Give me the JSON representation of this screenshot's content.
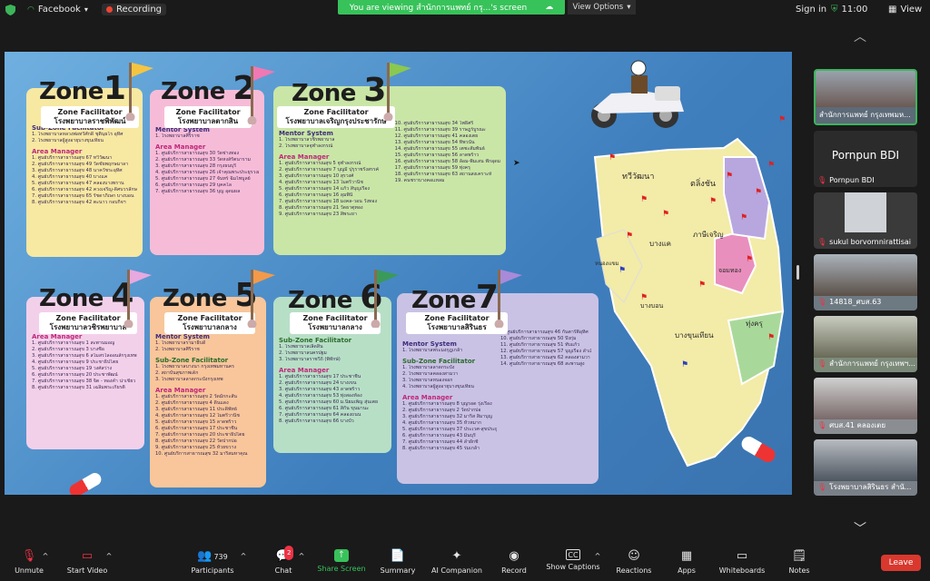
{
  "topbar": {
    "app_label": "Facebook",
    "recording_label": "Recording",
    "share_banner": "You are viewing สำนักการแพทย์ กรุ...'s screen",
    "view_options": "View Options",
    "sign_in": "Sign in",
    "time": "11:00",
    "view_label": "View"
  },
  "slide": {
    "zones": [
      {
        "title": "Zone",
        "num": "1",
        "fac_label": "Zone Facilitator",
        "fac_name": "โรงพยาบาลราชพิพัฒน์",
        "sections": [
          {
            "head": "Sub-Zone Facilitator",
            "lines": [
              "1. โรงพยาบาลหลวงพ่อทวีศักดิ์ ชุตินฺธโร อุทิศ",
              "2. โรงพยาบาลผู้สูงอายุบางขุนเทียน"
            ]
          },
          {
            "head": "Area Manager",
            "lines": [
              "1. ศูนย์บริการสาธารณสุข 67 ทวีวัฒนา",
              "2. ศูนย์บริการสาธารณสุข 49 วัดชัยพฤกษมาลา",
              "3. ศูนย์บริการสาธารณสุข 48 นาควัชระอุทิศ",
              "4. ศูนย์บริการสาธารณสุข 40 บางแค",
              "5. ศูนย์บริการสาธารณสุข 47 คลองบางพราน",
              "6. ศูนย์บริการสาธารณสุข 42 ควงเจริญ-ดิศบวรลักษณ์ ฐานปัญญา",
              "7. ศูนย์บริการสาธารณสุข 65 รัชดาภิเษก บางบอน",
              "8. ศูนย์บริการสาธารณสุข 42 ตะนาว กอบกิจฯ"
            ]
          }
        ]
      },
      {
        "title": "Zone",
        "num": "2",
        "fac_label": "Zone Facilitator",
        "fac_name": "โรงพยาบาลตากสิน",
        "sections": [
          {
            "head": "Mentor System",
            "lines": [
              "1. โรงพยาบาลศิริราช"
            ]
          },
          {
            "head": "Area Manager",
            "lines": [
              "1. ศูนย์บริการสาธารณสุข 30 วัดช่างทอง",
              "2. ศูนย์บริการสาธารณสุข 33 วัดหงส์รัตนาราม",
              "3. ศูนย์บริการสาธารณสุข 28 กรุงธนบุรี",
              "4. ศูนย์บริการสาธารณสุข 26 เจ้าคุณพระประยุรวงศ์",
              "5. ศูนย์บริการสาธารณสุข 27 จันทร์ ฉิมไพบูลย์",
              "6. ศูนย์บริการสาธารณสุข 29 บุคคโล",
              "7. ศูนย์บริการสาธารณสุข 36 บุญ อุดมผล"
            ]
          }
        ]
      },
      {
        "title": "Zone",
        "num": "3",
        "fac_label": "Zone Facilitator",
        "fac_name": "โรงพยาบาลเจริญกรุงประชารักษ์",
        "sections": [
          {
            "head": "Mentor System",
            "lines": [
              "1. โรงพยาบาลวชิรพยาบาล",
              "2. โรงพยาบาลจุฬาลงกรณ์"
            ]
          },
          {
            "head": "Area Manager",
            "lines": [
              "1. ศูนย์บริการสาธารณสุข 5 จุฬาลงกรณ์",
              "2. ศูนย์บริการสาธารณสุข 7 บุญมี ปุรุราชรังสรรค์",
              "3. ศูนย์บริการสาธารณสุข 10 สุรวงศ์",
              "4. ศูนย์บริการสาธารณสุข 13 ไมตรีวานิช",
              "5. ศูนย์บริการสาธารณสุข 14 แก้ว สีบุญเรือง",
              "6. ศูนย์บริการสาธารณสุข 16 ลุมพินี",
              "7. ศูนย์บริการสาธารณสุข 18 มงคล-วอน วังทอง",
              "8. ศูนย์บริการสาธารณสุข 21 วัดธาตุทอง",
              "9. ศูนย์บริการสาธารณสุข 23 สี่พระยา",
              "10. ศูนย์บริการสาธารณสุข 34 โพธิศรี",
              "11. ศูนย์บริการสาธารณสุข 39 ราษฎร์บูรณะ",
              "12. ศูนย์บริการสาธารณสุข 41 คลองเตย",
              "13. ศูนย์บริการสาธารณสุข 54 ทิพวนัน",
              "14. ศูนย์บริการสาธารณสุข 55 เตชะสัมพันธ์",
              "15. ศูนย์บริการสาธารณสุข 56 ลาดพร้าว",
              "16. ศูนย์บริการสาธารณสุข 58 ล้อม-พิมเสน ฟักอุดม",
              "17. ศูนย์บริการสาธารณสุข 59 ทุ่งครุ",
              "18. ศูนย์บริการสาธารณสุข 63 สถานสงเคราะห์",
              "19. คนชราบางคอแหลม"
            ]
          }
        ]
      },
      {
        "title": "Zone",
        "num": "4",
        "fac_label": "Zone Facilitator",
        "fac_name": "โรงพยาบาลวชิรพยาบาล",
        "sections": [
          {
            "head": "Area Manager",
            "lines": [
              "1. ศูนย์บริการสาธารณสุข 1 สะพานมอญ",
              "2. ศูนย์บริการสาธารณสุข 3 บางซื่อ",
              "3. ศูนย์บริการสาธารณสุข 6 สโมสรไลออนส์กรุงเทพ",
              "4. ศูนย์บริการสาธารณสุข 9 ประชาธิปไตย",
              "5. ศูนย์บริการสาธารณสุข 19 วงศ์สว่าง",
              "6. ศูนย์บริการสาธารณสุข 20 ประชาพัฒน์",
              "7. ศูนย์บริการสาธารณสุข 38 จิต - ทองคำ น่าเชี่ยว",
              "8. ศูนย์บริการสาธารณสุข 31 เฉลิมพระเกียรติ"
            ]
          }
        ]
      },
      {
        "title": "Zone",
        "num": "5",
        "fac_label": "Zone Facilitator",
        "fac_name": "โรงพยาบาลกลาง",
        "sections": [
          {
            "head": "Mentor System",
            "lines": [
              "1. โรงพยาบาลรามาธิบดี",
              "2. โรงพยาบาลศิริราช"
            ]
          },
          {
            "head": "Sub-Zone Facilitator",
            "lines": [
              "1. โรงพยาบาลบางนา กรุงเทพมหานคร",
              "2. สถาบันสุขภาพเด็ก",
              "3. โรงพยาบาลลาดกระบังกรุงเทพ"
            ]
          },
          {
            "head": "Area Manager",
            "lines": [
              "1. ศูนย์บริการสาธารณสุข 2 วัดมักกะสัน",
              "2. ศูนย์บริการสาธารณสุข 4 ดินแดง",
              "3. ศูนย์บริการสาธารณสุข 11 ประดิพัทธ์",
              "4. ศูนย์บริการสาธารณสุข 12 ไมตรีวานิช",
              "5. ศูนย์บริการสาธารณสุข 15 ลาดพร้าว",
              "6. ศูนย์บริการสาธารณสุข 17 ประชาชื่น",
              "7. ศูนย์บริการสาธารณสุข 20 ประชาธิปไตย",
              "8. ศูนย์บริการสาธารณสุข 22 วัดปากบ่อ",
              "9. ศูนย์บริการสาธารณสุข 25 ห้วยขวาง",
              "10. ศูนย์บริการสาธารณสุข 32 มาริสมหาคุณ"
            ]
          }
        ]
      },
      {
        "title": "Zone",
        "num": "6",
        "fac_label": "Zone Facilitator",
        "fac_name": "โรงพยาบาลกลาง",
        "sections": [
          {
            "head": "Sub-Zone Facilitator",
            "lines": [
              "1. โรงพยาบาลเลิดสิน",
              "2. โรงพยาบาลนครปฐม",
              "3. โรงพยาบาลราชวิถี (พิทักษ์)"
            ]
          },
          {
            "head": "Area Manager",
            "lines": [
              "1. ศูนย์บริการสาธารณสุข 17 ประชาชื่น",
              "2. ศูนย์บริการสาธารณสุข 24 บางเขน",
              "3. ศูนย์บริการสาธารณสุข 43 ลาดพร้าว",
              "4. ศูนย์บริการสาธารณสุข 53 ทุ่งสองห้อง",
              "5. ศูนย์บริการสาธารณสุข 60 ม.นิยมเพ็ญ สุ่นเตย",
              "6. ศูนย์บริการสาธารณสุข 61 สีกัน ขุนมานะ",
              "7. ศูนย์บริการสาธารณสุข 64 คลองถนน",
              "8. ศูนย์บริการสาธารณสุข 66 บางบัว"
            ]
          }
        ]
      },
      {
        "title": "Zone",
        "num": "7",
        "fac_label": "Zone Facilitator",
        "fac_name": "โรงพยาบาลสิรินธร",
        "sections": [
          {
            "head": "Mentor System",
            "lines": [
              "1. โรงพยาบาลพระมงกุฎเกล้า"
            ]
          },
          {
            "head": "Sub-Zone Facilitator",
            "lines": [
              "1. โรงพยาบาลลาดกระบัง",
              "2. โรงพยาบาลคลองสามวา",
              "3. โรงพยาบาลหนองจอก",
              "4. โรงพยาบาลผู้สูงอายุบางขุนเทียน"
            ]
          },
          {
            "head": "Area Manager",
            "lines": [
              "1. ศูนย์บริการสาธารณสุข 8 บุญรอด รุ่งเรือง",
              "2. ศูนย์บริการสาธารณสุข 2 วัดปากบ่อ",
              "3. ศูนย์บริการสาธารณสุข 32 มาริส สิมาบุญ",
              "4. ศูนย์บริการสาธารณสุข 35 หัวหมาก",
              "5. ศูนย์บริการสาธารณสุข 37 ประเวศ-สุขประยูร",
              "6. ศูนย์บริการสาธารณสุข 43 มีนบุรี",
              "7. ศูนย์บริการสาธารณสุข 44 ลำผักชี",
              "8. ศูนย์บริการสาธารณสุข 45 ร่มเกล้า",
              "9. ศูนย์บริการสาธารณสุข 46 กันตารัติอุทิศ",
              "10. ศูนย์บริการสาธารณสุข 50 บึงกุ่ม",
              "11. ศูนย์บริการสาธารณสุข 51 ทับแก้ว",
              "12. ศูนย์บริการสาธารณสุข 57 บุญเรือง ล้ำเลิศ",
              "13. ศูนย์บริการสาธารณสุข 62 คลองสามวา",
              "14. ศูนย์บริการสาธารณสุข 68 สะพานสูง"
            ]
          }
        ]
      }
    ],
    "map_labels": [
      "ทวีวัฒนา",
      "ตลิ่งชัน",
      "ภาษีเจริญ",
      "บางแค",
      "หนองแขม",
      "บางบอน",
      "จอมทอง",
      "บางขุนเทียน",
      "ทุ่งครุ"
    ]
  },
  "participants_panel": {
    "tiles": [
      {
        "name": "สำนักการแพทย์ กรุงเทพมห...",
        "muted": false
      },
      {
        "big": "Pornpun BDI",
        "name": "Pornpun BDI",
        "muted": true
      },
      {
        "name": "sukul borvornnirattisai",
        "muted": true
      },
      {
        "name": "14818_ศบส.63",
        "muted": true
      },
      {
        "name": "สำนักการแพทย์ กรุงเทพฯ...",
        "muted": true
      },
      {
        "name": "ศบส.41 คลองเตย",
        "muted": true
      },
      {
        "name": "โรงพยาบาลสิรินธร สำนั...",
        "muted": true
      }
    ]
  },
  "bottombar": {
    "unmute": "Unmute",
    "start_video": "Start Video",
    "participants": "Participants",
    "participants_count": "739",
    "chat": "Chat",
    "chat_badge": "2",
    "share_screen": "Share Screen",
    "summary": "Summary",
    "ai_companion": "AI Companion",
    "record": "Record",
    "show_captions": "Show Captions",
    "reactions": "Reactions",
    "apps": "Apps",
    "whiteboards": "Whiteboards",
    "notes": "Notes",
    "leave": "Leave"
  },
  "colors": {
    "share_green": "#38c25a",
    "leave_red": "#d9382e",
    "slide_bg": "#4b89c8"
  }
}
